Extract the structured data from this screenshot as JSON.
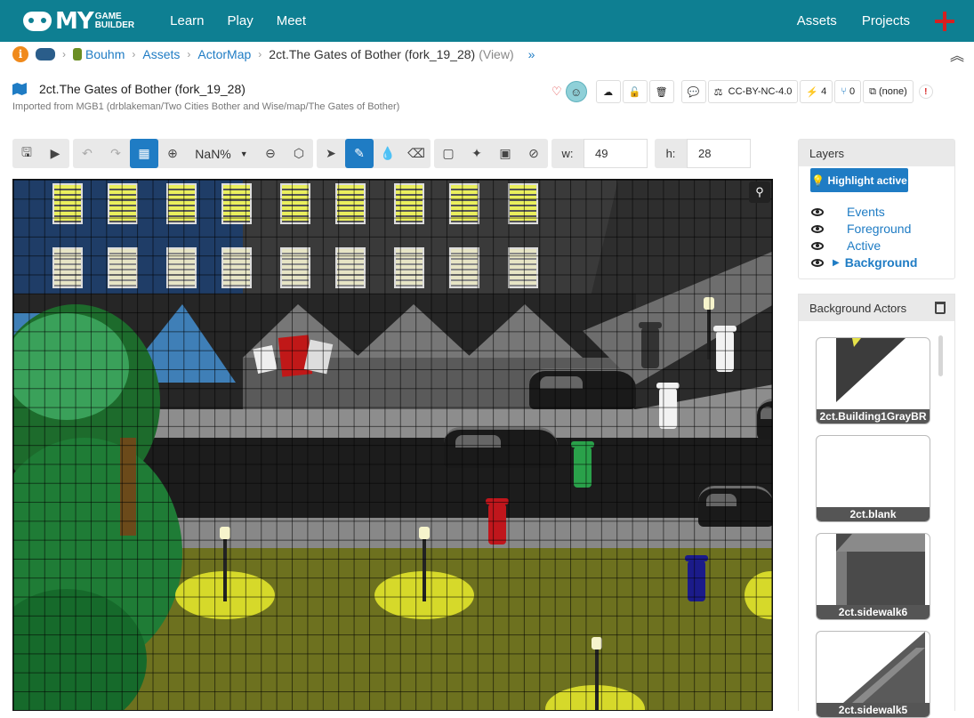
{
  "nav": {
    "logo_main": "MY",
    "logo_sub_1": "GAME",
    "logo_sub_2": "BUILDER",
    "links": [
      "Learn",
      "Play",
      "Meet"
    ],
    "right_links": [
      "Assets",
      "Projects"
    ]
  },
  "breadcrumb": {
    "user": "Bouhm",
    "assets": "Assets",
    "kind": "ActorMap",
    "current": "2ct.The Gates of Bother (fork_19_28)",
    "mode": "(View)"
  },
  "asset": {
    "title": "2ct.The Gates of Bother (fork_19_28)",
    "imported_from": "Imported from MGB1 (drblakeman/Two Cities Bother and Wise/map/The Gates of Bother)",
    "license": "CC-BY-NC-4.0",
    "bolt_count": "4",
    "fork_count": "0",
    "project": "(none)",
    "alert": "!"
  },
  "toolbar": {
    "zoom": "NaN%",
    "w_label": "w:",
    "w_value": "49",
    "h_label": "h:",
    "h_value": "28"
  },
  "layers": {
    "title": "Layers",
    "highlight_label": "Highlight active",
    "items": [
      "Events",
      "Foreground",
      "Active",
      "Background"
    ]
  },
  "background_actors": {
    "title": "Background Actors",
    "tiles": [
      "2ct.Building1GrayBR",
      "2ct.blank",
      "2ct.sidewalk6",
      "2ct.sidewalk5"
    ]
  },
  "colors": {
    "nav_bg": "#0e7f92",
    "accent": "#1f7cc4",
    "grass": "#6d711f",
    "lamp_pool": "#d6d92a"
  }
}
